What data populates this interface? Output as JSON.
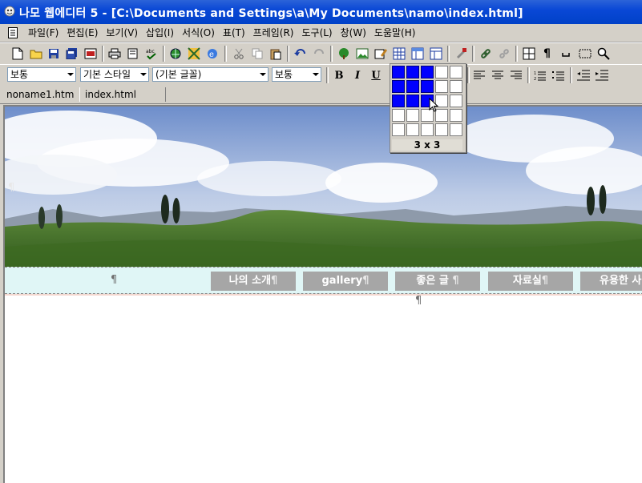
{
  "window": {
    "title": "나모 웹에디터 5 - [C:\\Documents and Settings\\a\\My Documents\\namo\\index.html]"
  },
  "menu": {
    "items": [
      "파일(F)",
      "편집(E)",
      "보기(V)",
      "삽입(I)",
      "서식(O)",
      "표(T)",
      "프레임(R)",
      "도구(L)",
      "창(W)",
      "도움말(H)"
    ]
  },
  "toolbar": {
    "icons": [
      "new-document-icon",
      "open-folder-icon",
      "save-icon",
      "save-all-icon",
      "preview-icon",
      "print-icon",
      "print-preview-icon",
      "spell-check-icon",
      "publish-icon",
      "site-manager-icon",
      "browser-preview-icon",
      "cut-icon",
      "copy-icon",
      "paste-icon",
      "undo-icon",
      "redo-icon",
      "tree-image-icon",
      "image-icon",
      "edit-image-icon",
      "insert-table-icon",
      "frame-icon",
      "layout-icon",
      "format-painter-icon",
      "link-icon",
      "unlink-icon",
      "table-grid-icon",
      "paragraph-mark-icon",
      "space-mark-icon",
      "layer-box-icon",
      "zoom-icon"
    ]
  },
  "format": {
    "paragraph_style": "보통",
    "char_style": "기본 스타일",
    "font": "(기본 글꼴)",
    "size": "보통",
    "bold": "B",
    "italic": "I",
    "underline": "U"
  },
  "tabs": [
    "noname1.htm",
    "index.html"
  ],
  "table_picker": {
    "rows": 5,
    "cols": 5,
    "selected_rows": 3,
    "selected_cols": 3,
    "label": "3 x 3"
  },
  "nav": {
    "items": [
      "나의 소개",
      "gallery",
      "좋은 글",
      "자료실",
      "유용한 사"
    ]
  },
  "paragraph_mark": "¶",
  "colors": {
    "titlebar": "#0a48d6",
    "nav_button": "#a6a6a6",
    "nav_row": "#e0f6f6",
    "grid_selected": "#0000ff"
  }
}
